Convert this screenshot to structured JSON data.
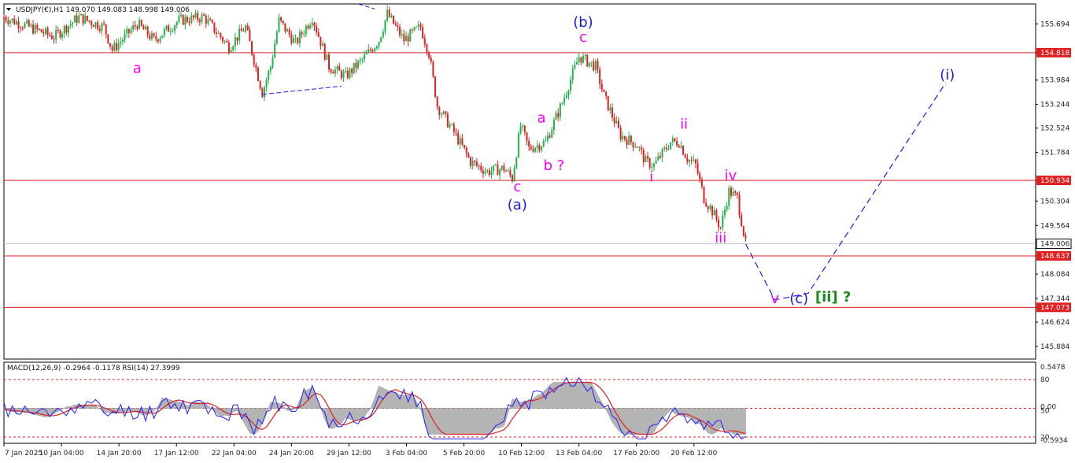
{
  "header": {
    "main": "USDJPY(€),H1  149.070 149.083 148.998 149.006",
    "indicator": "MACD(12,26,9) -0.2964 -0.1178 RSI(14) 27.3999"
  },
  "chart_data": {
    "type": "line",
    "symbol": "USDJPY(€),H1",
    "ohlc": {
      "open": 149.07,
      "high": 149.083,
      "low": 148.998,
      "close": 149.006
    },
    "ylim": [
      145.5,
      156.3
    ],
    "y_ticks": [
      "155.694",
      "154.818",
      "153.984",
      "153.244",
      "152.524",
      "151.784",
      "150.934",
      "150.304",
      "149.564",
      "149.006",
      "148.637",
      "148.084",
      "147.344",
      "147.073",
      "146.624",
      "145.884"
    ],
    "x_ticks": [
      "7 Jan 2025",
      "10 Jan 04:00",
      "14 Jan 20:00",
      "17 Jan 12:00",
      "22 Jan 04:00",
      "24 Jan 20:00",
      "29 Jan 12:00",
      "3 Feb 04:00",
      "5 Feb 20:00",
      "10 Feb 12:00",
      "13 Feb 04:00",
      "17 Feb 20:00",
      "20 Feb 12:00"
    ],
    "price_path": [
      {
        "t": 0,
        "p": 155.9
      },
      {
        "t": 6,
        "p": 155.3
      },
      {
        "t": 9,
        "p": 155.9
      },
      {
        "t": 12,
        "p": 155.6
      },
      {
        "t": 13,
        "p": 154.9
      },
      {
        "t": 16,
        "p": 155.7
      },
      {
        "t": 18,
        "p": 155.2
      },
      {
        "t": 21,
        "p": 155.8
      },
      {
        "t": 24,
        "p": 155.9
      },
      {
        "t": 27,
        "p": 155.0
      },
      {
        "t": 29,
        "p": 155.6
      },
      {
        "t": 31,
        "p": 153.6
      },
      {
        "t": 32,
        "p": 154.4
      },
      {
        "t": 33,
        "p": 155.8
      },
      {
        "t": 35,
        "p": 155.1
      },
      {
        "t": 37,
        "p": 155.9
      },
      {
        "t": 39,
        "p": 154.4
      },
      {
        "t": 41,
        "p": 154.1
      },
      {
        "t": 43,
        "p": 154.6
      },
      {
        "t": 45,
        "p": 155.2
      },
      {
        "t": 46,
        "p": 156.0
      },
      {
        "t": 48,
        "p": 155.2
      },
      {
        "t": 50,
        "p": 155.6
      },
      {
        "t": 51,
        "p": 154.8
      },
      {
        "t": 52,
        "p": 153.2
      },
      {
        "t": 54,
        "p": 152.4
      },
      {
        "t": 56,
        "p": 151.5
      },
      {
        "t": 58,
        "p": 151.2
      },
      {
        "t": 60,
        "p": 151.3
      },
      {
        "t": 61,
        "p": 151.0
      },
      {
        "t": 62,
        "p": 152.6
      },
      {
        "t": 63,
        "p": 151.9
      },
      {
        "t": 65,
        "p": 152.1
      },
      {
        "t": 67,
        "p": 153.3
      },
      {
        "t": 69,
        "p": 154.7
      },
      {
        "t": 71,
        "p": 154.4
      },
      {
        "t": 72,
        "p": 153.5
      },
      {
        "t": 74,
        "p": 152.3
      },
      {
        "t": 76,
        "p": 152.0
      },
      {
        "t": 77,
        "p": 151.5
      },
      {
        "t": 78,
        "p": 151.4
      },
      {
        "t": 80,
        "p": 152.1
      },
      {
        "t": 81,
        "p": 152.1
      },
      {
        "t": 82,
        "p": 151.6
      },
      {
        "t": 83,
        "p": 151.4
      },
      {
        "t": 84,
        "p": 150.4
      },
      {
        "t": 85,
        "p": 150.0
      },
      {
        "t": 86,
        "p": 149.5
      },
      {
        "t": 87,
        "p": 150.6
      },
      {
        "t": 88,
        "p": 150.4
      },
      {
        "t": 89,
        "p": 149.0
      }
    ],
    "indicator_ylim": [
      -0.5934,
      0.5478
    ],
    "indicator_ticks": [
      "0.5478",
      "80",
      "0.00",
      "50",
      "20",
      "-0.5934"
    ],
    "indicator_levels": [
      80,
      50,
      20
    ],
    "colors": {
      "bull_candle": "#22b24c",
      "bear_candle": "#e02020",
      "horizontal_line": "#e02020",
      "price_tag": "#e02020",
      "wave_blue": "#1a1adc",
      "wave_magenta": "#ff00ff",
      "wave_green": "#1a8a1a",
      "projection": "#1a1adc",
      "rsi_line": "#2020ff",
      "signal_line": "#e02020",
      "macd_hist": "#b4b4b4"
    }
  },
  "horizontal_lines": [
    {
      "price": 154.818,
      "label": "154.818"
    },
    {
      "price": 150.934,
      "label": "150.934"
    },
    {
      "price": 148.637,
      "label": "148.637"
    },
    {
      "price": 147.073,
      "label": "147.073"
    }
  ],
  "current_price": {
    "price": 149.006,
    "label": "149.006"
  },
  "projection_path": [
    {
      "t": 89,
      "p": 149.0
    },
    {
      "t": 92.5,
      "p": 147.3
    },
    {
      "t": 96.5,
      "p": 147.5
    },
    {
      "t": 113,
      "p": 153.9
    }
  ],
  "wave_labels": [
    {
      "text": "a",
      "t": 16,
      "p": 154.2,
      "color": "magenta"
    },
    {
      "text": "(b)",
      "t": 69.5,
      "p": 155.6,
      "color": "blue"
    },
    {
      "text": "c",
      "t": 69.5,
      "p": 155.15,
      "color": "magenta"
    },
    {
      "text": "a",
      "t": 64.5,
      "p": 152.7,
      "color": "magenta"
    },
    {
      "text": "b ?",
      "t": 66,
      "p": 151.25,
      "color": "magenta"
    },
    {
      "text": "c",
      "t": 61.6,
      "p": 150.6,
      "color": "magenta"
    },
    {
      "text": "(a)",
      "t": 61.6,
      "p": 150.05,
      "color": "blue"
    },
    {
      "text": "i",
      "t": 77.7,
      "p": 150.9,
      "color": "magenta"
    },
    {
      "text": "ii",
      "t": 81.6,
      "p": 152.5,
      "color": "magenta"
    },
    {
      "text": "iv",
      "t": 87.2,
      "p": 150.95,
      "color": "magenta"
    },
    {
      "text": "iii",
      "t": 86,
      "p": 149.05,
      "color": "magenta"
    },
    {
      "text": "v",
      "t": 92.5,
      "p": 147.2,
      "color": "magenta"
    },
    {
      "text": "(c)",
      "t": 95.4,
      "p": 147.2,
      "color": "blue"
    },
    {
      "text": "[ii] ?",
      "t": 99.5,
      "p": 147.25,
      "color": "green"
    },
    {
      "text": "(i)",
      "t": 113.2,
      "p": 154.0,
      "color": "blue"
    }
  ]
}
